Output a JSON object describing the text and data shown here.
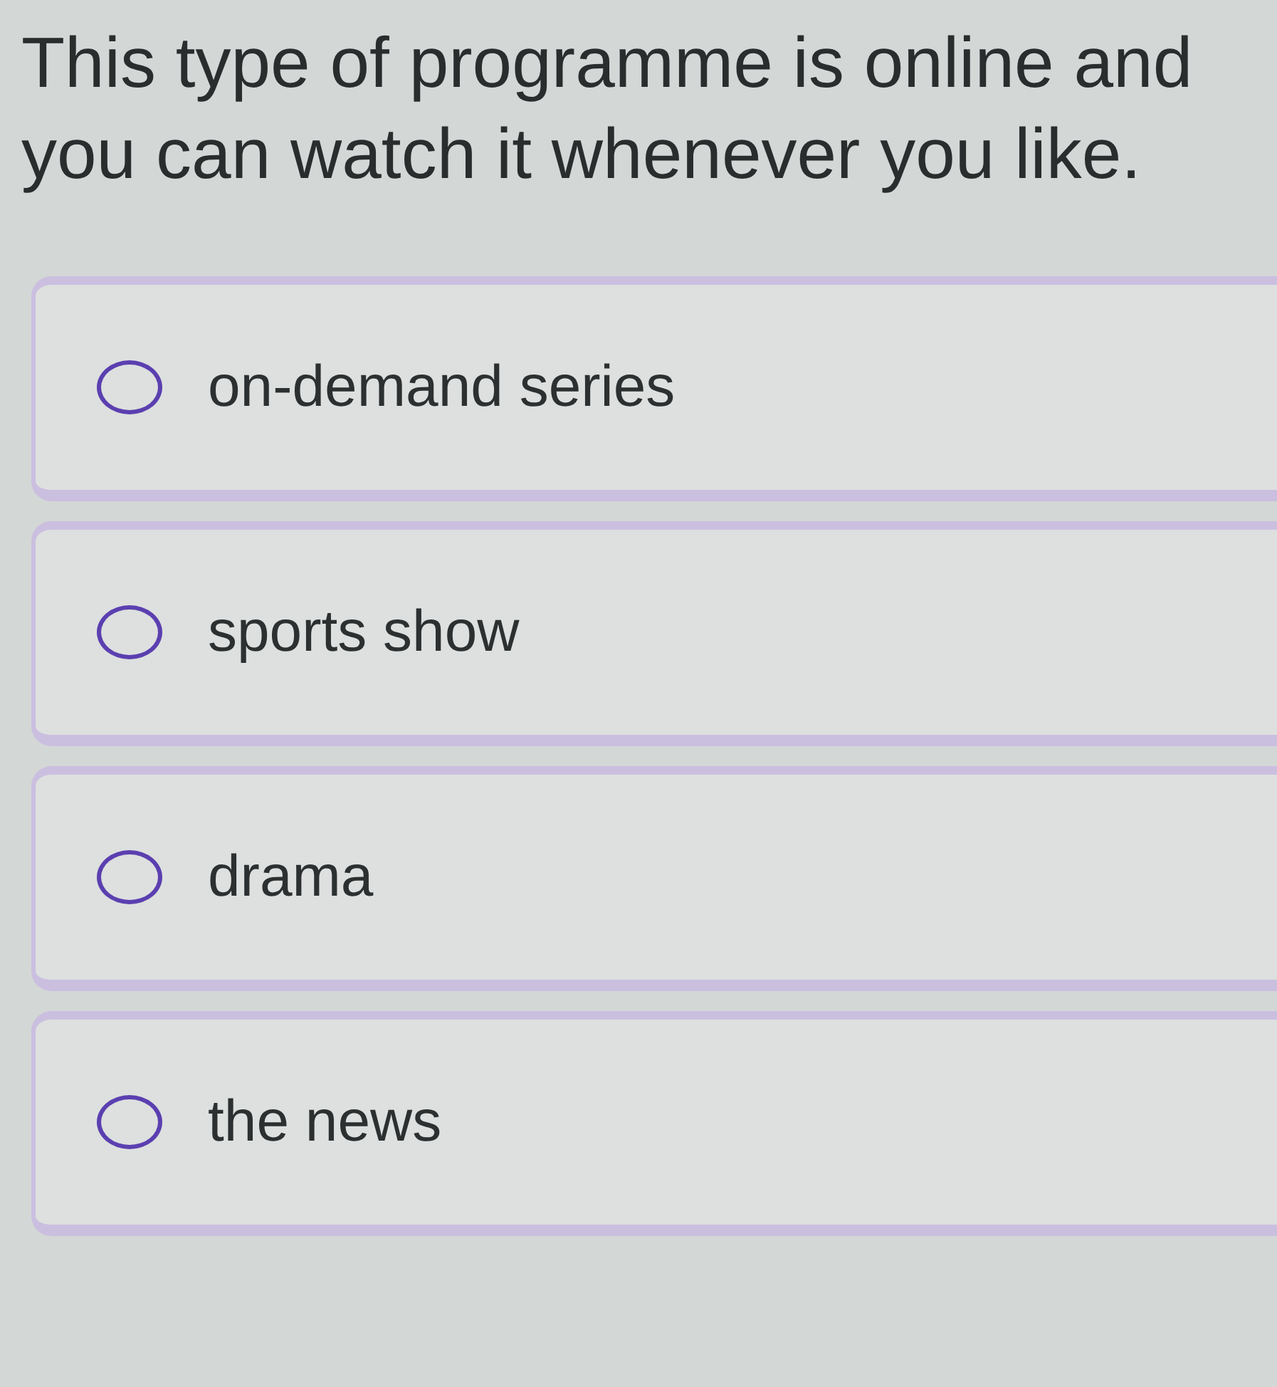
{
  "question": "This type of programme is online and you can watch it whenever you like.",
  "options": [
    {
      "label": "on-demand series",
      "selected": false
    },
    {
      "label": "sports show",
      "selected": false
    },
    {
      "label": "drama",
      "selected": false
    },
    {
      "label": "the news",
      "selected": false
    }
  ]
}
